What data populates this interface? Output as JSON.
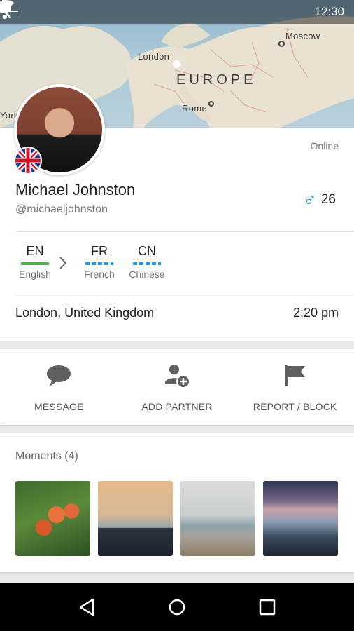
{
  "status_bar": {
    "time": "12:30"
  },
  "map": {
    "labels": {
      "london": "London",
      "moscow": "Moscow",
      "europe": "EUROPE",
      "rome": "Rome",
      "york": "York"
    }
  },
  "profile": {
    "status": "Online",
    "name": "Michael Johnston",
    "handle": "@michaeljohnston",
    "age": "26",
    "gender_symbol": "♂",
    "languages": [
      {
        "code": "EN",
        "name": "English",
        "color": "#4caf50"
      },
      {
        "code": "FR",
        "name": "French",
        "color": "#2196f3"
      },
      {
        "code": "CN",
        "name": "Chinese",
        "color": "#2196f3"
      }
    ],
    "location": "London, United Kingdom",
    "local_time": "2:20 pm"
  },
  "actions": {
    "message": {
      "label": "MESSAGE",
      "icon": "chat-bubble-icon"
    },
    "add_partner": {
      "label": "ADD PARTNER",
      "icon": "add-person-icon"
    },
    "report_block": {
      "label": "REPORT / BLOCK",
      "icon": "flag-icon"
    }
  },
  "moments": {
    "title": "Moments (4)",
    "items": [
      "tulips-photo",
      "lifeguard-tower-photo",
      "coastline-cliffs-photo",
      "rocky-shore-dusk-photo"
    ]
  },
  "colors": {
    "accent_male": "#1e9ad6",
    "english_level": "#4caf50",
    "learning_level": "#2196f3"
  }
}
